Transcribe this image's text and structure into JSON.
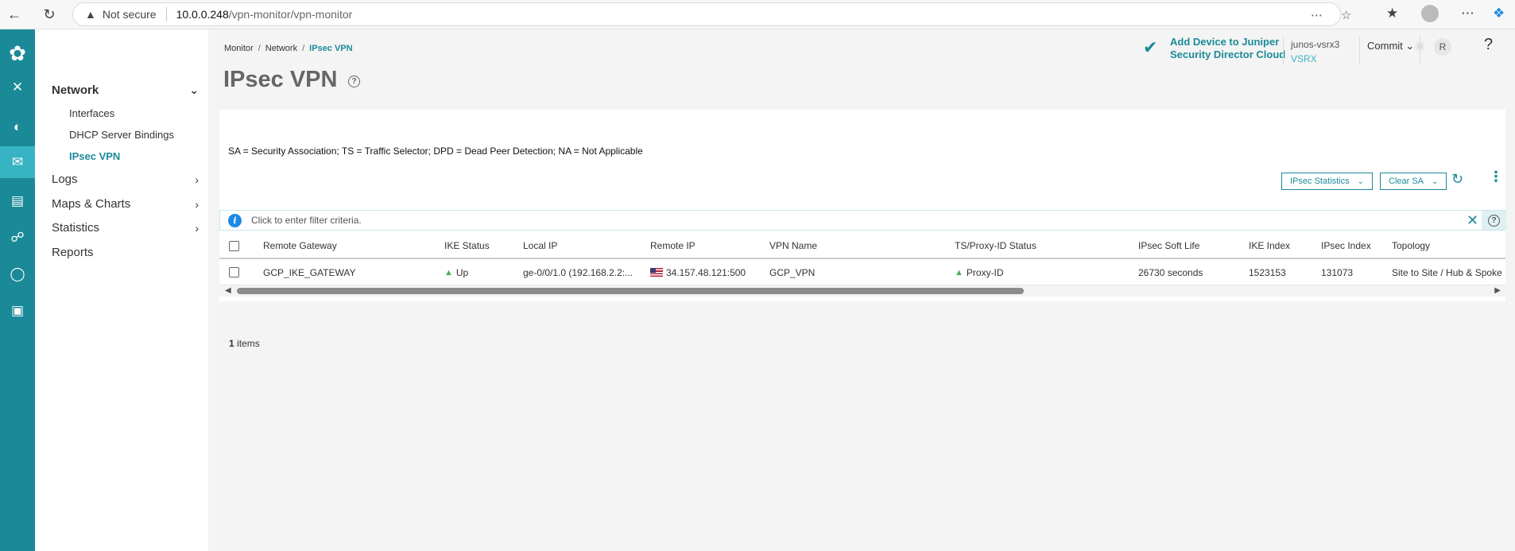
{
  "browser": {
    "security": "Not secure",
    "url_host": "10.0.0.248",
    "url_path": "/vpn-monitor/vpn-monitor"
  },
  "nav": {
    "network": {
      "label": "Network",
      "items": [
        "Interfaces",
        "DHCP Server Bindings",
        "IPsec VPN"
      ]
    },
    "groups": [
      "Logs",
      "Maps & Charts",
      "Statistics",
      "Reports"
    ]
  },
  "breadcrumb": [
    "Monitor",
    "Network",
    "IPsec VPN"
  ],
  "page_title": "IPsec VPN",
  "header": {
    "jsd_line1": "Add Device to Juniper",
    "jsd_line2": "Security Director Cloud",
    "device_name": "junos-vsrx3",
    "device_model": "VSRX",
    "commit_label": "Commit",
    "avatar_initial": "R",
    "help": "?"
  },
  "legend_text": "SA = Security Association; TS = Traffic Selector; DPD = Dead Peer Detection; NA = Not Applicable",
  "toolbar": {
    "ipsec_stats_label": "IPsec Statistics",
    "clear_sa_label": "Clear SA"
  },
  "filter_placeholder": "Click to enter filter criteria.",
  "table": {
    "columns": [
      "Remote Gateway",
      "IKE Status",
      "Local IP",
      "Remote IP",
      "VPN Name",
      "TS/Proxy-ID Status",
      "IPsec Soft Life",
      "IKE Index",
      "IPsec Index",
      "Topology"
    ],
    "rows": [
      {
        "remote_gateway": "GCP_IKE_GATEWAY",
        "ike_status": "Up",
        "local_ip": "ge-0/0/1.0 (192.168.2.2:...",
        "remote_ip": "34.157.48.121:500",
        "vpn_name": "GCP_VPN",
        "ts_status": "Proxy-ID",
        "soft_life": "26730 seconds",
        "ike_index": "1523153",
        "ipsec_index": "131073",
        "topology": "Site to Site / Hub & Spoke"
      }
    ]
  },
  "item_count": "1",
  "item_count_suffix": " items",
  "colors": {
    "teal": "#1b8a98",
    "rail_active": "#38b3c3",
    "status_up": "#4caf50"
  }
}
